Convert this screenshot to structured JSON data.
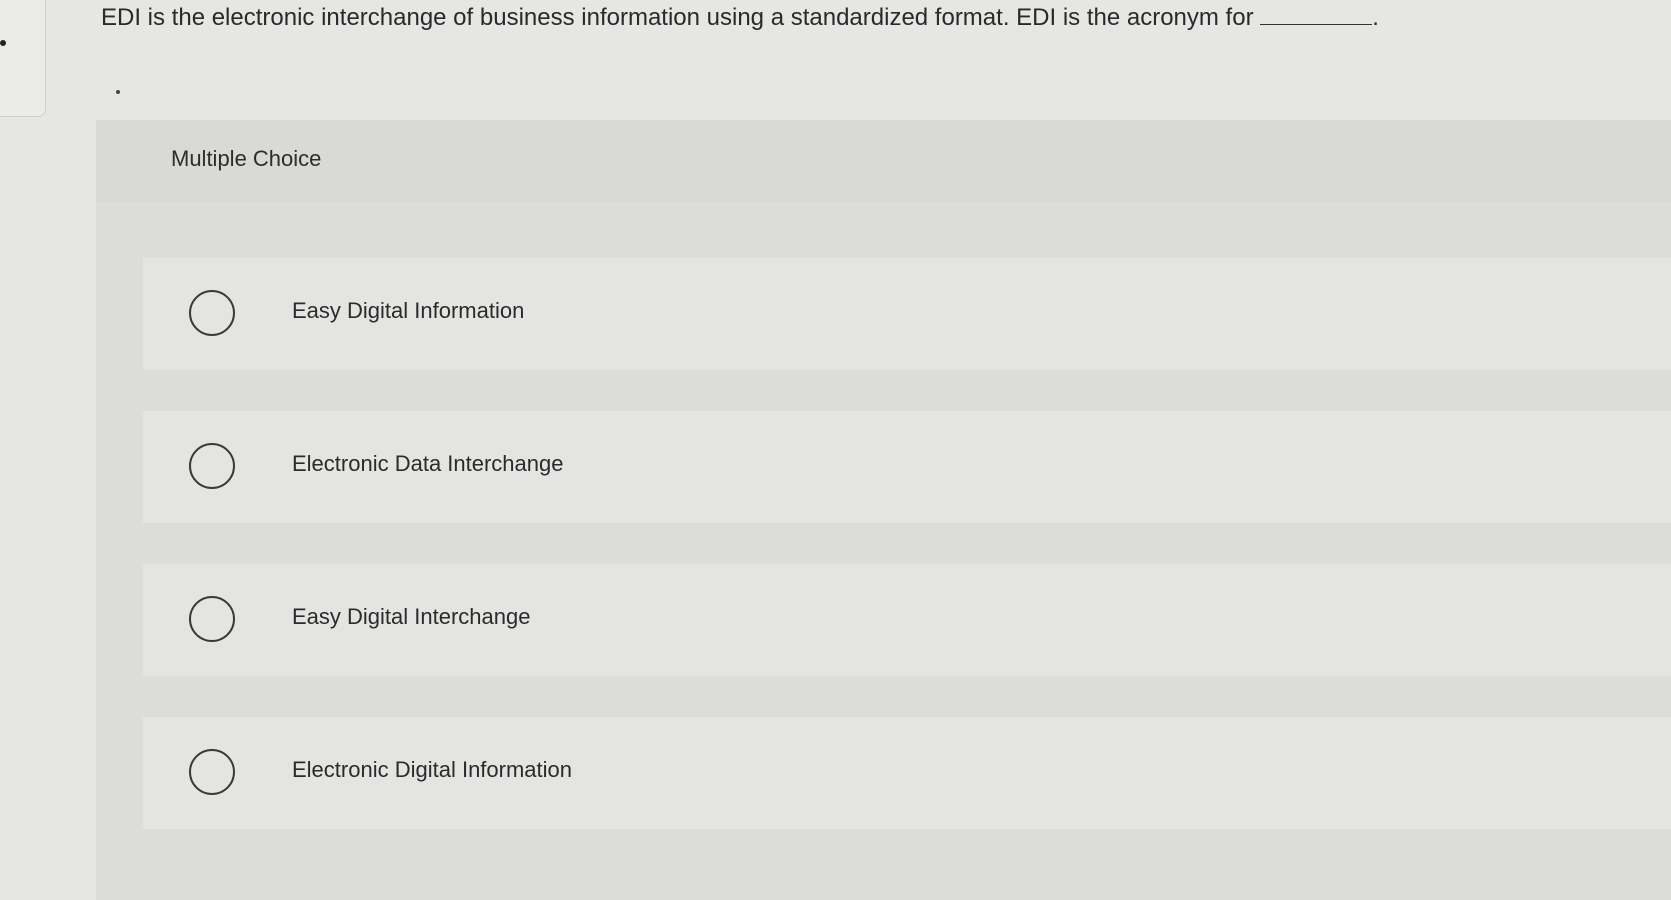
{
  "question": {
    "text": "EDI is the electronic interchange of business information using a standardized format. EDI is the acronym for",
    "end_punct": "."
  },
  "multiple_choice": {
    "label": "Multiple Choice",
    "options": [
      {
        "label": "Easy Digital Information",
        "selected": false
      },
      {
        "label": "Electronic Data Interchange",
        "selected": false
      },
      {
        "label": "Easy Digital Interchange",
        "selected": false
      },
      {
        "label": "Electronic Digital Information",
        "selected": false
      }
    ]
  }
}
